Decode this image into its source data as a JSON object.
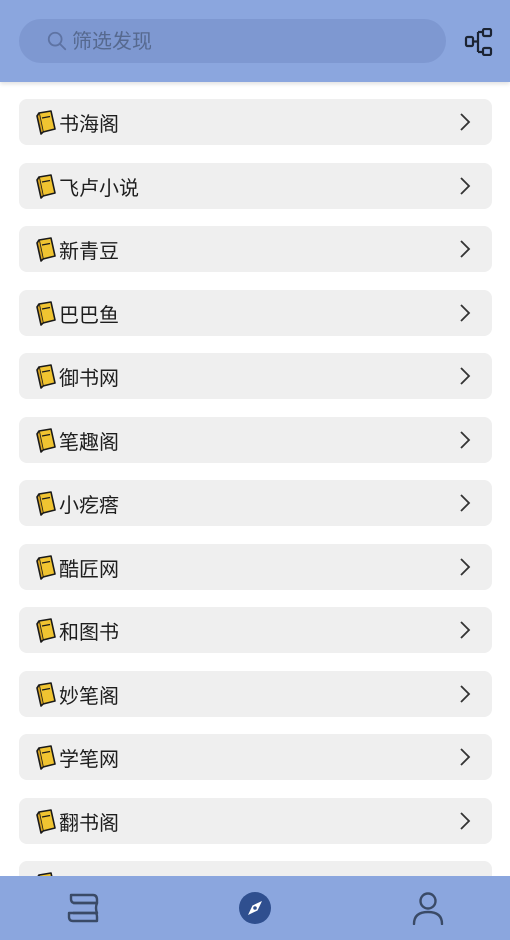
{
  "search": {
    "placeholder": "筛选发现"
  },
  "sources": [
    {
      "label": "书海阁"
    },
    {
      "label": "飞卢小说"
    },
    {
      "label": "新青豆"
    },
    {
      "label": "巴巴鱼"
    },
    {
      "label": "御书网"
    },
    {
      "label": "笔趣阁"
    },
    {
      "label": "小疙瘩"
    },
    {
      "label": "酷匠网"
    },
    {
      "label": "和图书"
    },
    {
      "label": "妙笔阁"
    },
    {
      "label": "学笔网"
    },
    {
      "label": "翻书阁"
    },
    {
      "label": ""
    }
  ],
  "icons": {
    "search": "search-icon",
    "layout": "layout-toggle-icon",
    "item": "book-icon",
    "chevron": "chevron-right-icon",
    "nav_bookshelf": "bookshelf-icon",
    "nav_discover": "compass-icon",
    "nav_profile": "user-icon"
  },
  "colors": {
    "bar": "#8ba6de",
    "search_bg": "#7e98d1",
    "item_bg": "#efefef",
    "active_nav": "#2f4f8f",
    "inactive_nav": "#3a4a66"
  }
}
